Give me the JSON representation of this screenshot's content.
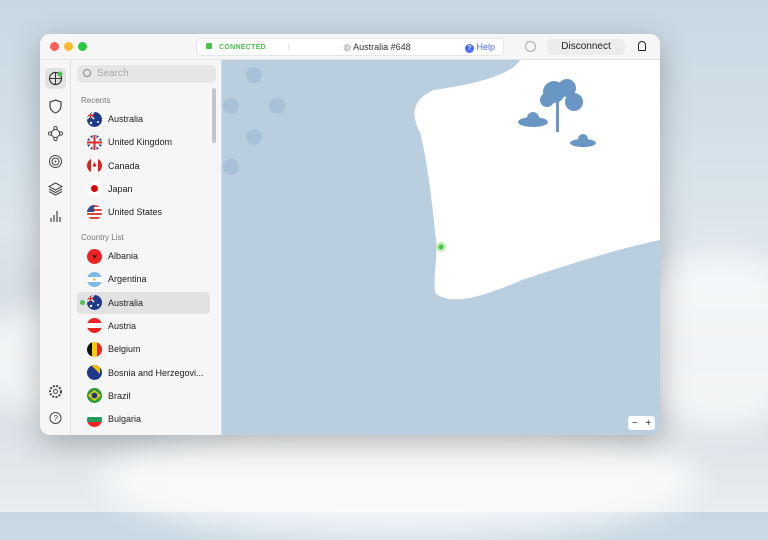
{
  "titlebar": {
    "status": "CONNECTED",
    "server": "Australia #648",
    "help": "Help",
    "disconnect": "Disconnect"
  },
  "search": {
    "placeholder": "Search"
  },
  "recents": {
    "label": "Recents",
    "items": [
      {
        "name": "Australia",
        "flag": "au"
      },
      {
        "name": "United Kingdom",
        "flag": "gb"
      },
      {
        "name": "Canada",
        "flag": "ca"
      },
      {
        "name": "Japan",
        "flag": "jp"
      },
      {
        "name": "United States",
        "flag": "us"
      }
    ]
  },
  "countries": {
    "label": "Country List",
    "items": [
      {
        "name": "Albania",
        "flag": "al"
      },
      {
        "name": "Argentina",
        "flag": "ar"
      },
      {
        "name": "Australia",
        "flag": "au",
        "selected": true,
        "connected": true
      },
      {
        "name": "Austria",
        "flag": "at"
      },
      {
        "name": "Belgium",
        "flag": "be"
      },
      {
        "name": "Bosnia and Herzegovi...",
        "flag": "ba"
      },
      {
        "name": "Brazil",
        "flag": "br"
      },
      {
        "name": "Bulgaria",
        "flag": "bg"
      }
    ]
  },
  "rail": [
    "globe-icon",
    "shield-icon",
    "meshnet-icon",
    "target-icon",
    "layers-icon",
    "stats-icon",
    "settings-icon",
    "support-icon"
  ],
  "map": {
    "zoom_out": "−",
    "zoom_in": "+"
  },
  "colors": {
    "connected": "#4cc24c",
    "water": "#b9cfe0",
    "land": "#ffffff",
    "accent": "#4a6cf7"
  }
}
